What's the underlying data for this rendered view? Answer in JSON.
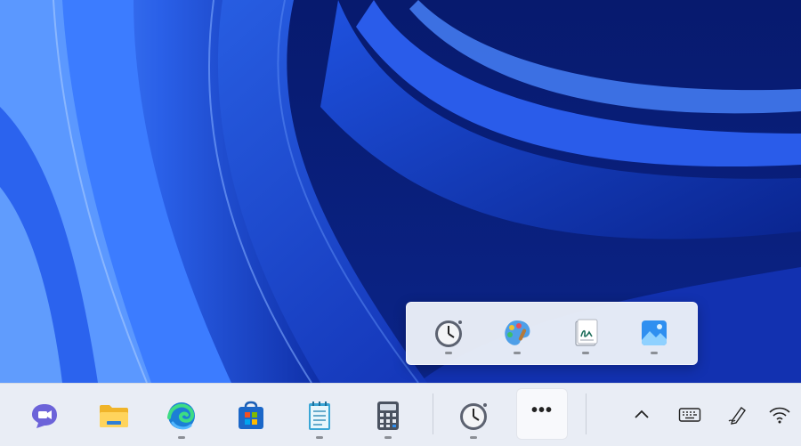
{
  "desktop": {
    "wallpaper": "windows-11-bloom-blue",
    "colors": {
      "deep": "#0a1f78",
      "mid": "#1b45d6",
      "light": "#3f7bf0",
      "highlight": "#6aa6ff"
    }
  },
  "overflow_flyout": {
    "items": [
      {
        "icon": "clock-app-icon",
        "running": true
      },
      {
        "icon": "paint-app-icon",
        "running": true
      },
      {
        "icon": "journal-app-icon",
        "running": true
      },
      {
        "icon": "photos-app-icon",
        "running": true
      }
    ]
  },
  "taskbar": {
    "background": "#e9edf5",
    "apps": [
      {
        "icon": "teams-chat-icon",
        "running": false
      },
      {
        "icon": "file-explorer-icon",
        "running": false
      },
      {
        "icon": "edge-browser-icon",
        "running": true
      },
      {
        "icon": "microsoft-store-icon",
        "running": false
      },
      {
        "icon": "notepad-icon",
        "running": true
      },
      {
        "icon": "calculator-icon",
        "running": true
      },
      {
        "icon": "clock-app-icon",
        "running": true
      }
    ],
    "more_button": {
      "label": "•••",
      "active": true
    },
    "tray": {
      "items": [
        {
          "icon": "chevron-up-icon"
        },
        {
          "icon": "touch-keyboard-icon"
        },
        {
          "icon": "pen-menu-icon"
        },
        {
          "icon": "wifi-icon"
        }
      ]
    }
  }
}
